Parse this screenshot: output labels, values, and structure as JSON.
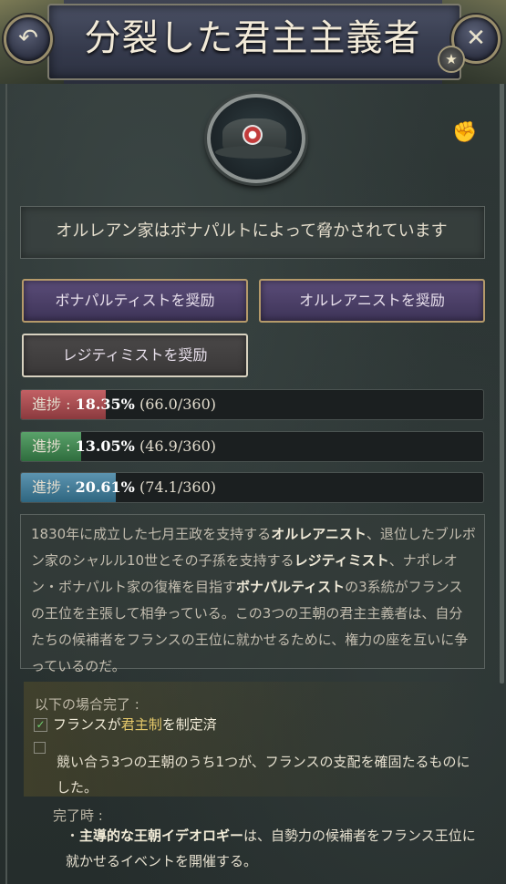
{
  "header": {
    "title": "分裂した君主主義者",
    "back_glyph": "↶",
    "close_glyph": "✕",
    "star_glyph": "★"
  },
  "emblem": {
    "icon": "bicorne-hat-icon",
    "side_icon": "raised-fist-icon",
    "side_glyph": "✊"
  },
  "subtitle": "オルレアン家はボナパルトによって脅かされています",
  "buttons": {
    "encourage_bonapartists": "ボナパルティストを奨励",
    "encourage_orleanists": "オルレアニストを奨励",
    "encourage_legitimists": "レジティミストを奨励"
  },
  "progress": [
    {
      "label": "進捗 : ",
      "percent": "18.35%",
      "detail": " (66.0/360)",
      "fraction": 0.1835,
      "color": "#b04e52"
    },
    {
      "label": "進捗 : ",
      "percent": "13.05%",
      "detail": " (46.9/360)",
      "fraction": 0.1305,
      "color": "#4a8a58"
    },
    {
      "label": "進捗 : ",
      "percent": "20.61%",
      "detail": " (74.1/360)",
      "fraction": 0.2061,
      "color": "#4a82a0"
    }
  ],
  "description": {
    "p1": "1830年に成立した七月王政を支持する",
    "b1": "オルレアニスト",
    "p2": "、退位したブルボン家のシャルル10世とその子孫を支持する",
    "b2": "レジティミスト",
    "p3": "、ナポレオン・ボナパルト家の復権を目指す",
    "b3": "ボナパルティスト",
    "p4": "の3系統がフランスの王位を主張して相争っている。この3つの王朝の君主主義者は、自分たちの候補者をフランスの王位に就かせるために、権力の座を互いに争っているのだ。"
  },
  "conditions": {
    "header": "以下の場合完了 :",
    "item1_a": "フランスが",
    "item1_b": "君主制",
    "item1_c": "を制定済",
    "item1_checked": true,
    "item2": "競い合う3つの王朝のうち1つが、フランスの支配を確固たるものにした。",
    "item2_checked": false
  },
  "on_complete": {
    "header": "完了時 :",
    "bullet": "・",
    "bold": "主導的な王朝イデオロギー",
    "rest": "は、自勢力の候補者をフランス王位に就かせるイベントを開催する。"
  }
}
